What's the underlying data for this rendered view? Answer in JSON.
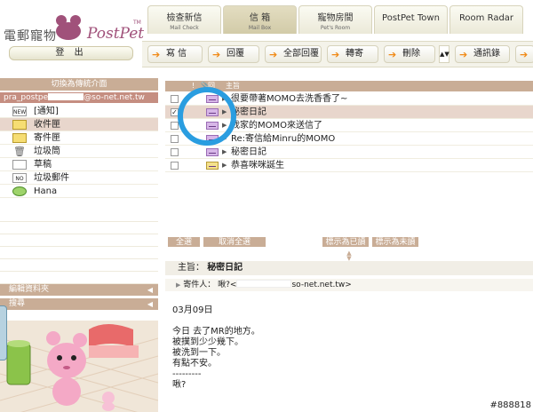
{
  "brand": {
    "cn": "電郵寵物",
    "name": "PostPet",
    "tm": "TM"
  },
  "header": {
    "logout": "登 出"
  },
  "tabs": [
    {
      "label": "檢查新信",
      "sub": "Mail Check"
    },
    {
      "label": "信 箱",
      "sub": "Mail Box"
    },
    {
      "label": "寵物房間",
      "sub": "Pet's Room"
    },
    {
      "label": "PostPet Town",
      "sub": ""
    },
    {
      "label": "Room Radar",
      "sub": ""
    }
  ],
  "toolbar": {
    "compose": "寫 信",
    "reply": "回覆",
    "reply_all": "全部回覆",
    "forward": "轉寄",
    "delete": "刪除",
    "address_book": "通訊錄"
  },
  "left": {
    "header": "切換為傳統介面",
    "account_prefix": "pra_postpe",
    "account_suffix": "@so-net.net.tw",
    "folders": [
      {
        "label": "[通知]",
        "icon": "notice-icon"
      },
      {
        "label": "收件匣",
        "icon": "inbox-icon"
      },
      {
        "label": "寄件匣",
        "icon": "outbox-icon"
      },
      {
        "label": "垃圾筒",
        "icon": "trash-icon"
      },
      {
        "label": "草稿",
        "icon": "draft-icon"
      },
      {
        "label": "垃圾郵件",
        "icon": "spam-icon"
      },
      {
        "label": "Hana",
        "icon": "hana-icon"
      }
    ],
    "edit_folder": "編輯資料夾",
    "search": "搜尋"
  },
  "list": {
    "header_flag": "!",
    "header_attach": "",
    "header_read": "回",
    "header_subject": "主旨",
    "rows": [
      {
        "subject": "很要帶著MOMO去洗香香了~",
        "checked": false
      },
      {
        "subject": "秘密日記",
        "checked": true
      },
      {
        "subject": "我家的MOMO來送信了",
        "checked": false
      },
      {
        "subject": "Re:寄信給Minru的MOMO",
        "checked": false
      },
      {
        "subject": "秘密日記",
        "checked": false
      },
      {
        "subject": "恭喜咪咪誕生",
        "checked": false
      }
    ]
  },
  "actions": {
    "select_all": "全選",
    "deselect_all": "取消全選",
    "mark_read": "標示為已讀",
    "mark_unread": "標示為未讀"
  },
  "preview": {
    "subject_label": "主旨：",
    "subject": "秘密日記",
    "from_label": "寄件人：",
    "from_name": "啾?<",
    "from_domain": "so-net.net.tw>",
    "body": "03月09日\n\n今日 去了MR的地方。\n被撲到少少幾下。\n被洗到一下。\n有點不安。\n---------\n啾?"
  },
  "watermark": "#888818",
  "colors": {
    "accent": "#c9ad96",
    "selected_row": "#e8d6cc",
    "circle": "#2a9de0",
    "arrow": "#f08a16"
  }
}
